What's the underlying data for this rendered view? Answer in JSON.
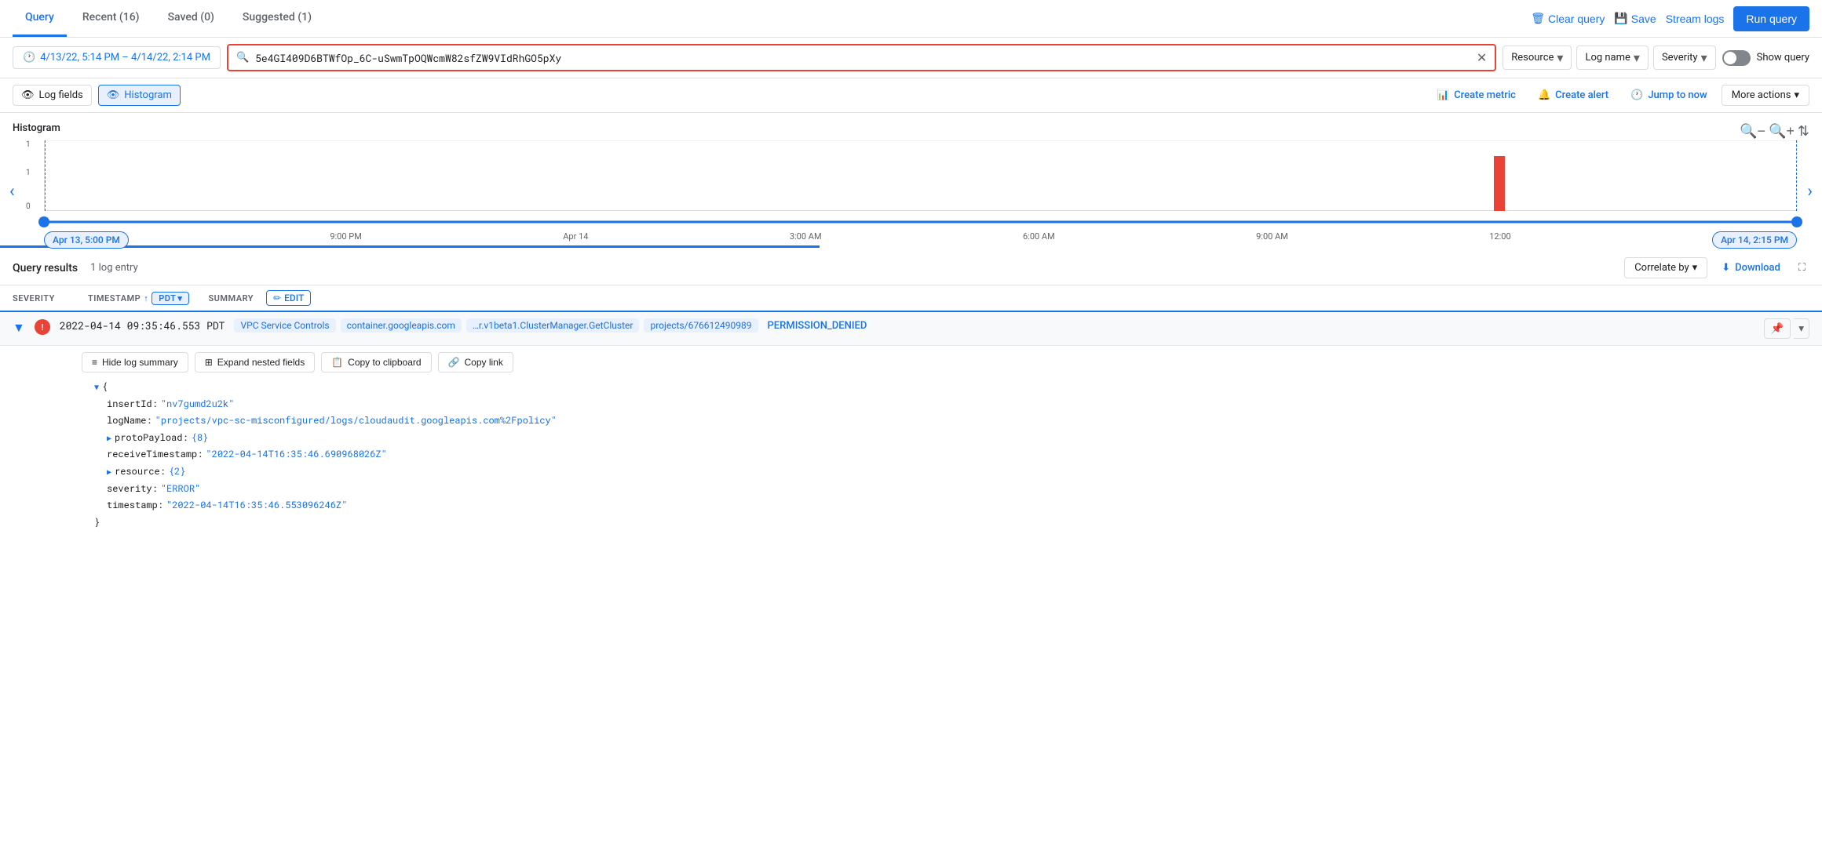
{
  "tabs": [
    {
      "label": "Query",
      "active": true
    },
    {
      "label": "Recent (16)",
      "active": false
    },
    {
      "label": "Saved (0)",
      "active": false
    },
    {
      "label": "Suggested (1)",
      "active": false
    }
  ],
  "topActions": {
    "clearQuery": "Clear query",
    "save": "Save",
    "streamLogs": "Stream logs",
    "runQuery": "Run query"
  },
  "searchRow": {
    "timeRange": "4/13/22, 5:14 PM – 4/14/22, 2:14 PM",
    "searchValue": "5e4GI409D6BTWfOp_6C-uSwmTpOQWcmW82sfZW9VIdRhGO5pXy",
    "filters": [
      "Resource",
      "Log name",
      "Severity"
    ],
    "showQuery": "Show query"
  },
  "toolbar": {
    "logFields": "Log fields",
    "histogram": "Histogram",
    "createMetric": "Create metric",
    "createAlert": "Create alert",
    "jumpToNow": "Jump to now",
    "moreActions": "More actions"
  },
  "histogram": {
    "title": "Histogram",
    "yLabels": [
      "1",
      "1",
      "0"
    ],
    "timeLabels": [
      "Apr 13, 5:00 PM",
      "9:00 PM",
      "Apr 14",
      "3:00 AM",
      "6:00 AM",
      "9:00 AM",
      "12:00"
    ],
    "startTime": "Apr 13, 5:00 PM",
    "endTime": "Apr 14, 2:15 PM",
    "barPosition": 83,
    "zoomIn": "zoom-in",
    "zoomOut": "zoom-out",
    "expand": "expand"
  },
  "queryResults": {
    "title": "Query results",
    "count": "1 log entry",
    "correlateBy": "Correlate by",
    "download": "Download",
    "fullscreen": "fullscreen"
  },
  "tableHeader": {
    "severity": "SEVERITY",
    "timestamp": "TIMESTAMP",
    "sortIcon": "↑",
    "pdt": "PDT",
    "summary": "SUMMARY",
    "edit": "EDIT"
  },
  "logEntry": {
    "timestamp": "2022-04-14 09:35:46.553 PDT",
    "tags": [
      "VPC Service Controls",
      "container.googleapis.com",
      "…r.v1beta1.ClusterManager.GetCluster",
      "projects/676612490989"
    ],
    "permission": "PERMISSION_DENIED",
    "expand": true
  },
  "logDetail": {
    "hideLogSummary": "Hide log summary",
    "expandNestedFields": "Expand nested fields",
    "copyToClipboard": "Copy to clipboard",
    "copyLink": "Copy link",
    "json": {
      "insertId": "nv7gumd2u2k",
      "logName": "projects/vpc-sc-misconfigured/logs/cloudaudit.googleapis.com%2Fpolicy",
      "protoPayload": "{8}",
      "receiveTimestamp": "2022-04-14T16:35:46.690968026Z",
      "resource": "{2}",
      "severity": "ERROR",
      "timestamp": "2022-04-14T16:35:46.553096246Z"
    }
  }
}
